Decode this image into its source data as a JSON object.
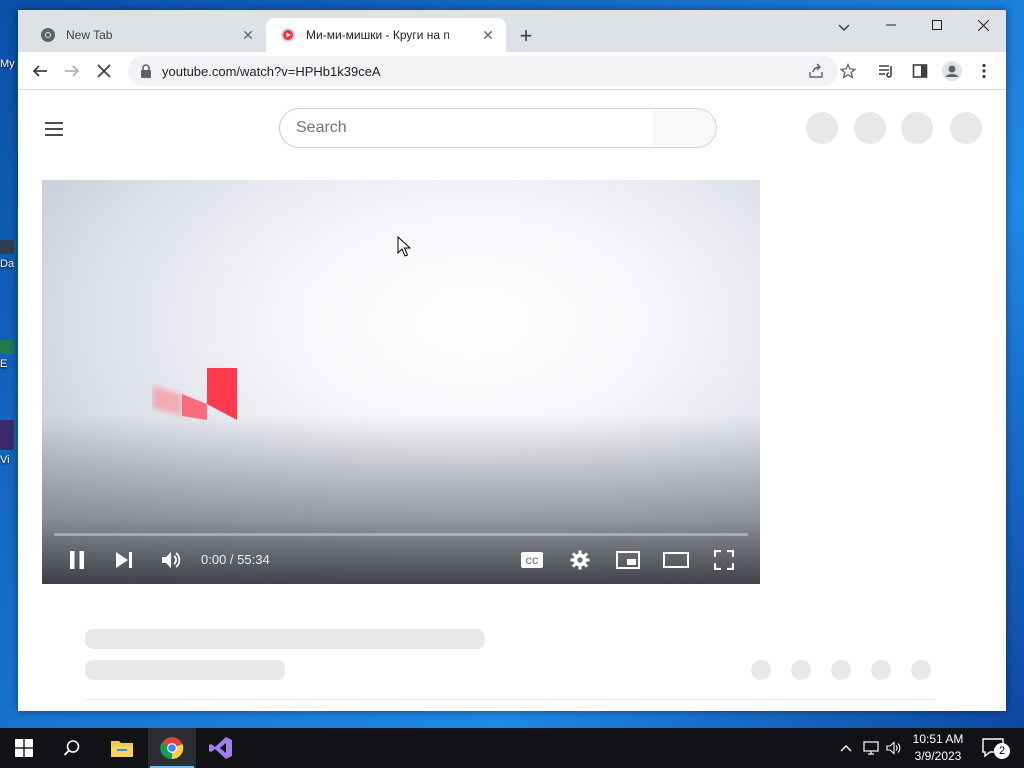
{
  "browser": {
    "tabs": [
      {
        "title": "New Tab",
        "active": false,
        "icon": "chrome-icon"
      },
      {
        "title": "Ми-ми-мишки - Круги на п",
        "active": true,
        "icon": "youtube-icon"
      }
    ],
    "url": "youtube.com/watch?v=HPHb1k39ceA"
  },
  "youtube": {
    "search_placeholder": "Search"
  },
  "player": {
    "time_display": "0:00 / 55:34",
    "state": "playing",
    "progress_fraction": 0
  },
  "desktop": {
    "icon_labels": [
      "My",
      "Da",
      "E",
      "Vi"
    ]
  },
  "taskbar": {
    "time": "10:51 AM",
    "date": "3/9/2023",
    "notification_count": "2"
  },
  "colors": {
    "accent_red": "#ff3a4c",
    "youtube_red": "#ff0000",
    "taskbar_bg": "#101216",
    "tabstrip_bg": "#dee1e6"
  }
}
